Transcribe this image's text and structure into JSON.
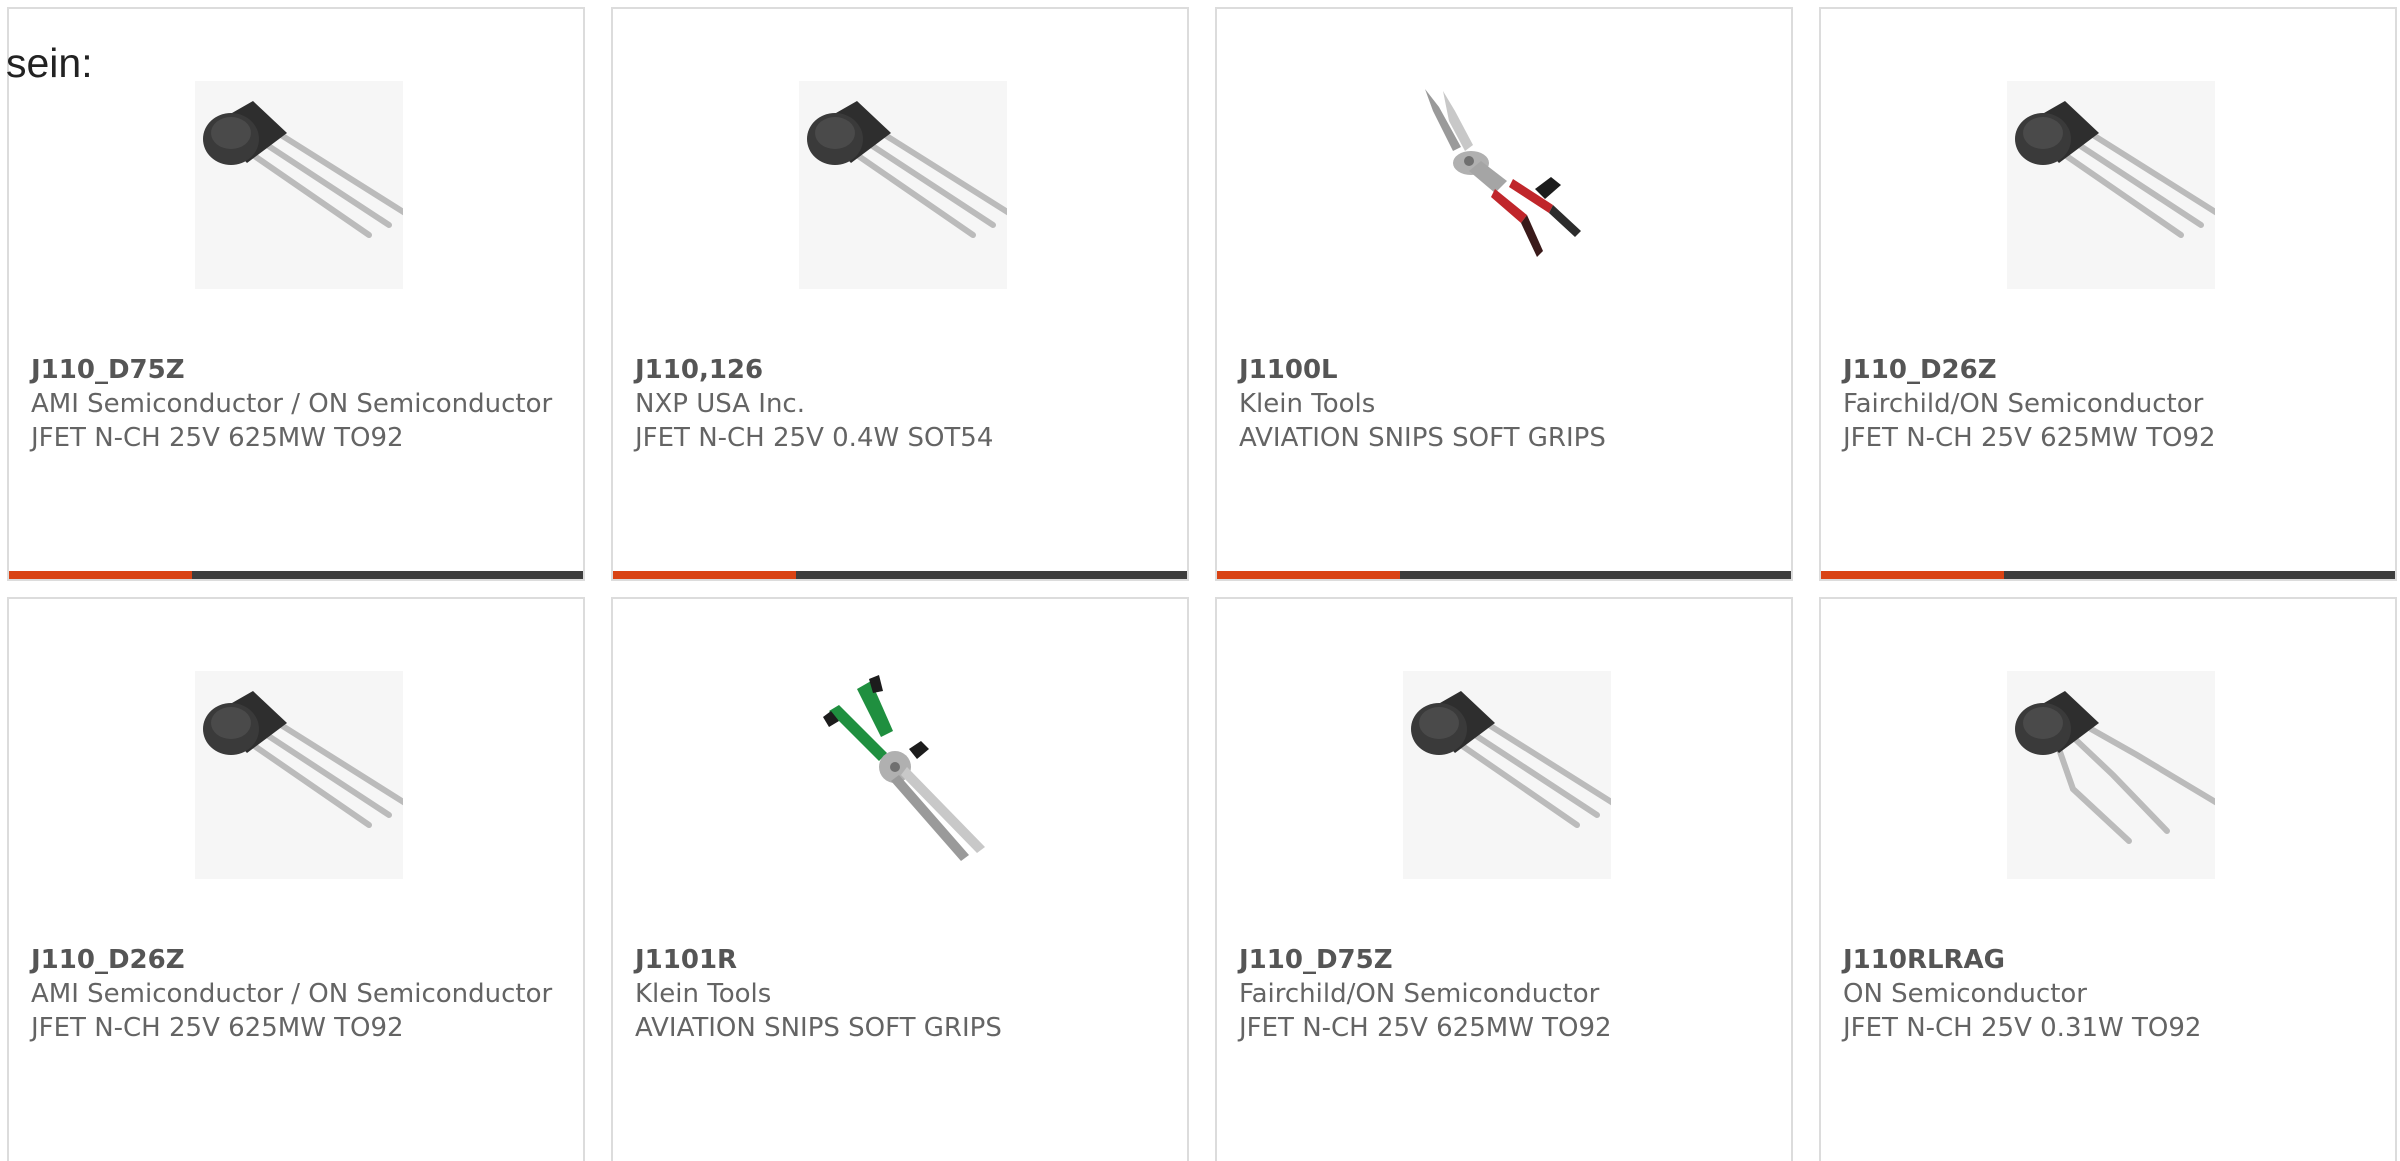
{
  "intro_text": "sein:",
  "colors": {
    "accent_bar": "#d94314",
    "dark_bar": "#3d3d3d",
    "card_border": "#dcdcdc"
  },
  "products": [
    {
      "part_number": "J110_D75Z",
      "manufacturer": "AMI Semiconductor / ON Semiconductor",
      "description": "JFET N-CH 25V 625MW TO92",
      "image_icon": "to92-transistor-icon"
    },
    {
      "part_number": "J110,126",
      "manufacturer": "NXP USA Inc.",
      "description": "JFET N-CH 25V 0.4W SOT54",
      "image_icon": "to92-transistor-icon"
    },
    {
      "part_number": "J1100L",
      "manufacturer": "Klein Tools",
      "description": "AVIATION SNIPS SOFT GRIPS",
      "image_icon": "aviation-snips-red-icon"
    },
    {
      "part_number": "J110_D26Z",
      "manufacturer": "Fairchild/ON Semiconductor",
      "description": "JFET N-CH 25V 625MW TO92",
      "image_icon": "to92-transistor-icon"
    },
    {
      "part_number": "J110_D26Z",
      "manufacturer": "AMI Semiconductor / ON Semiconductor",
      "description": "JFET N-CH 25V 625MW TO92",
      "image_icon": "to92-transistor-icon"
    },
    {
      "part_number": "J1101R",
      "manufacturer": "Klein Tools",
      "description": "AVIATION SNIPS SOFT GRIPS",
      "image_icon": "aviation-snips-green-icon"
    },
    {
      "part_number": "J110_D75Z",
      "manufacturer": "Fairchild/ON Semiconductor",
      "description": "JFET N-CH 25V 625MW TO92",
      "image_icon": "to92-transistor-icon"
    },
    {
      "part_number": "J110RLRAG",
      "manufacturer": "ON Semiconductor",
      "description": "JFET N-CH 25V 0.31W TO92",
      "image_icon": "to92-transistor-bent-leads-icon"
    }
  ]
}
